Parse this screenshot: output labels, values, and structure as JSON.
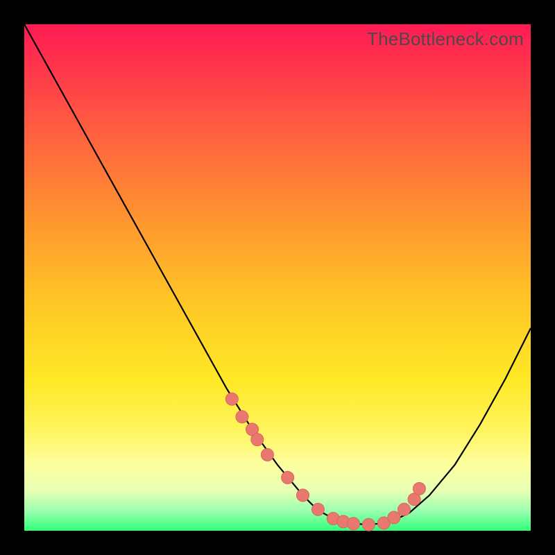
{
  "watermark": "TheBottleneck.com",
  "colors": {
    "frame": "#000000",
    "curve_stroke": "#000000",
    "marker_fill": "#e9786f",
    "marker_stroke": "#d8665f"
  },
  "chart_data": {
    "type": "line",
    "title": "",
    "xlabel": "",
    "ylabel": "",
    "xlim": [
      0,
      100
    ],
    "ylim": [
      0,
      100
    ],
    "series": [
      {
        "name": "bottleneck-curve",
        "x": [
          0,
          5,
          10,
          15,
          20,
          25,
          30,
          35,
          40,
          45,
          50,
          55,
          57,
          59,
          61,
          63,
          65,
          68,
          72,
          76,
          80,
          85,
          90,
          95,
          100
        ],
        "y": [
          100,
          91,
          82,
          73,
          64,
          55,
          46,
          37,
          28,
          20,
          13,
          7,
          5,
          3.5,
          2.4,
          1.8,
          1.4,
          1.2,
          1.6,
          3.5,
          7,
          13,
          21,
          30,
          40
        ]
      }
    ],
    "markers": {
      "name": "highlighted-points",
      "x": [
        41,
        43,
        45,
        46,
        48,
        52,
        55,
        58,
        61,
        63,
        65,
        68,
        71,
        73,
        75,
        77,
        78
      ],
      "y": [
        26,
        22.5,
        20,
        18,
        15,
        10.5,
        7,
        4.2,
        2.4,
        1.8,
        1.4,
        1.2,
        1.5,
        2.6,
        4.2,
        6.2,
        8.3
      ]
    }
  }
}
